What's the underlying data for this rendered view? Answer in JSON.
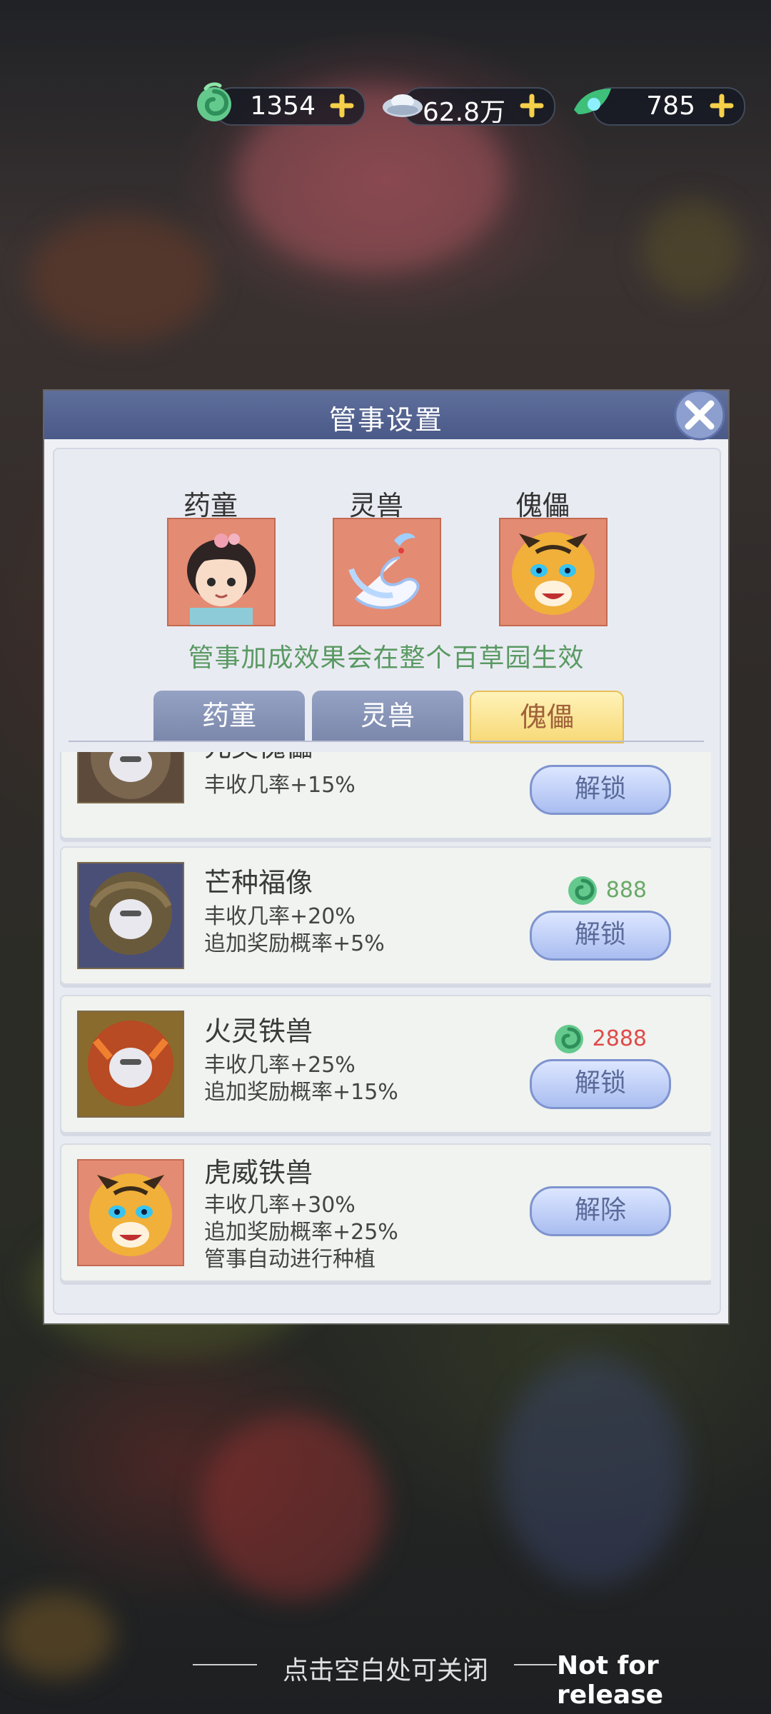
{
  "resources": [
    {
      "icon": "jade-swirl-icon",
      "value": "1354"
    },
    {
      "icon": "silver-ingot-icon",
      "value": "62.8万"
    },
    {
      "icon": "green-leaf-gem-icon",
      "value": "785"
    }
  ],
  "panel": {
    "title": "管事设置",
    "slots": [
      {
        "label": "药童",
        "avatar": "girl-portrait-icon"
      },
      {
        "label": "灵兽",
        "avatar": "white-crane-icon"
      },
      {
        "label": "傀儡",
        "avatar": "tiger-portrait-icon"
      }
    ],
    "notice": "管事加成效果会在整个百草园生效",
    "tabs": [
      "药童",
      "灵兽",
      "傀儡"
    ],
    "selected_tab": "傀儡"
  },
  "items": [
    {
      "name": "元英傀儡",
      "effects": [
        "丰收几率+15%"
      ],
      "button": "解锁"
    },
    {
      "name": "芒种福像",
      "effects": [
        "丰收几率+20%",
        "追加奖励概率+5%"
      ],
      "cost": "888",
      "cost_color": "#6aa96a",
      "button": "解锁"
    },
    {
      "name": "火灵铁兽",
      "effects": [
        "丰收几率+25%",
        "追加奖励概率+15%"
      ],
      "cost": "2888",
      "cost_color": "#e04a4a",
      "button": "解锁"
    },
    {
      "name": "虎威铁兽",
      "effects": [
        "丰收几率+30%",
        "追加奖励概率+25%",
        "管事自动进行种植"
      ],
      "button": "解除"
    }
  ],
  "footer": {
    "hint": "点击空白处可关闭",
    "watermark": "Not for release"
  }
}
